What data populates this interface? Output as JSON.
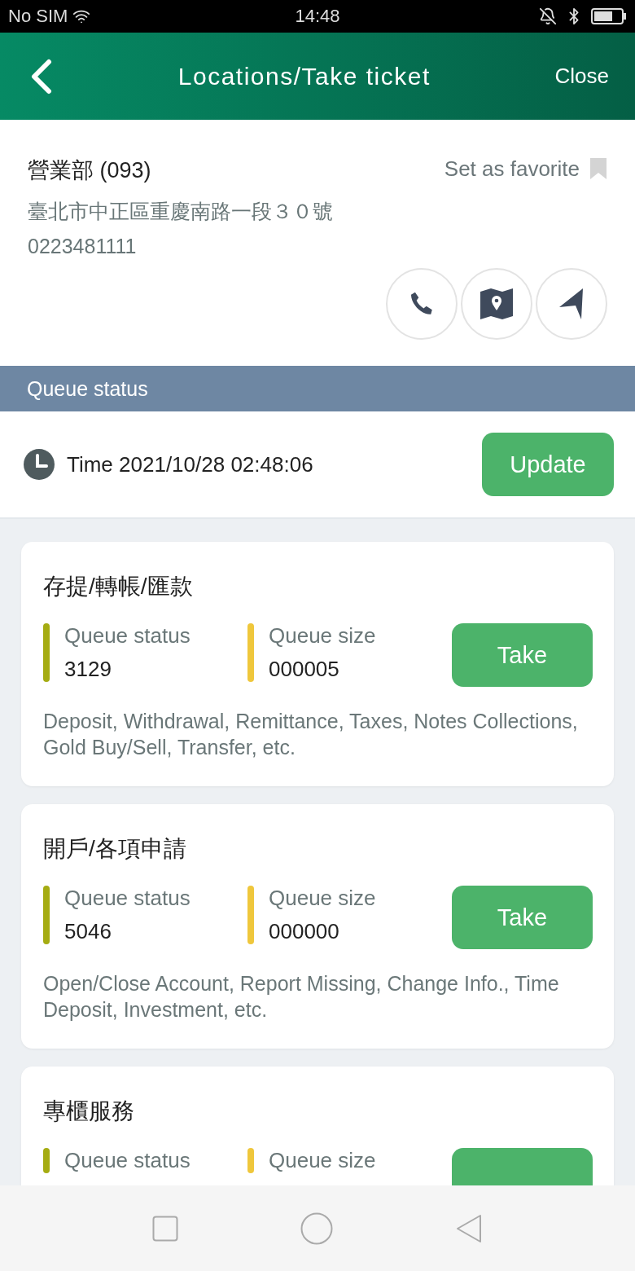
{
  "status_bar": {
    "carrier": "No SIM",
    "time": "14:48"
  },
  "header": {
    "title": "Locations/Take ticket",
    "close": "Close"
  },
  "branch": {
    "name": "營業部 (093)",
    "favorite_label": "Set as favorite",
    "favorite": false,
    "address": "臺北市中正區重慶南路一段３０號",
    "phone": "0223481111"
  },
  "queue_section": {
    "title": "Queue status",
    "time": "Time 2021/10/28 02:48:06",
    "update_button": "Update"
  },
  "services": [
    {
      "title": "存提/轉帳/匯款",
      "status_label": "Queue status",
      "status_value": "3129",
      "size_label": "Queue size",
      "size_value": "000005",
      "button": "Take",
      "description": "Deposit, Withdrawal, Remittance, Taxes, Notes Collections, Gold Buy/Sell, Transfer, etc."
    },
    {
      "title": "開戶/各項申請",
      "status_label": "Queue status",
      "status_value": "5046",
      "size_label": "Queue size",
      "size_value": "000000",
      "button": "Take",
      "description": "Open/Close Account, Report Missing, Change Info., Time Deposit, Investment, etc."
    },
    {
      "title": "專櫃服務",
      "status_label": "Queue status",
      "size_label": "Queue size"
    }
  ]
}
